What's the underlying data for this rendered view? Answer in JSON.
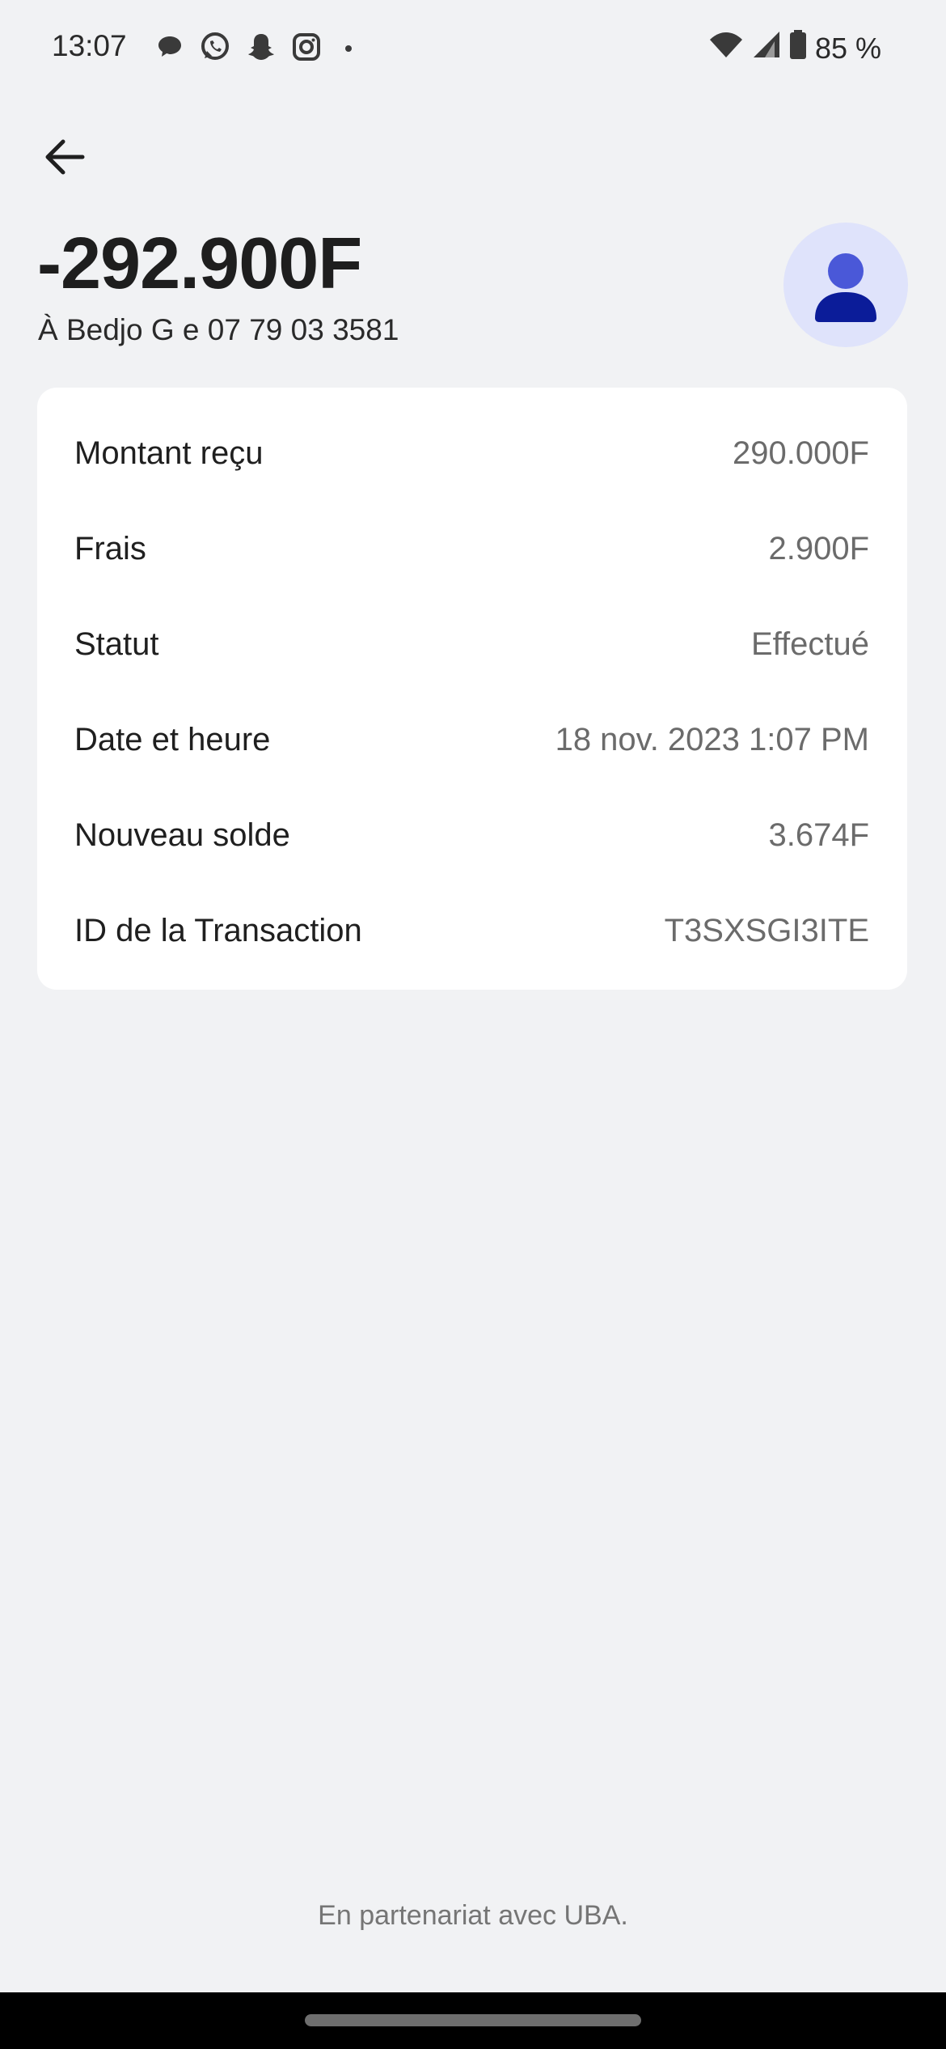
{
  "status_bar": {
    "time": "13:07",
    "notification_icons": [
      "chat-bubble-icon",
      "whatsapp-icon",
      "snapchat-icon",
      "instagram-icon",
      "dot-icon"
    ],
    "battery": "85 %"
  },
  "header": {
    "amount": "-292.900F",
    "recipient": "À Bedjo G e 07 79 03 3581"
  },
  "details": [
    {
      "label": "Montant reçu",
      "value": "290.000F"
    },
    {
      "label": "Frais",
      "value": "2.900F"
    },
    {
      "label": "Statut",
      "value": "Effectué"
    },
    {
      "label": "Date et heure",
      "value": "18 nov. 2023 1:07 PM"
    },
    {
      "label": "Nouveau solde",
      "value": "3.674F"
    },
    {
      "label": "ID de la Transaction",
      "value": "T3SXSGI3ITE"
    }
  ],
  "footer": {
    "text": "En partenariat avec UBA."
  },
  "colors": {
    "background": "#f1f2f4",
    "card": "#ffffff",
    "avatar_bg": "#dfe3fb",
    "avatar_fg": "#1a2fb0"
  }
}
